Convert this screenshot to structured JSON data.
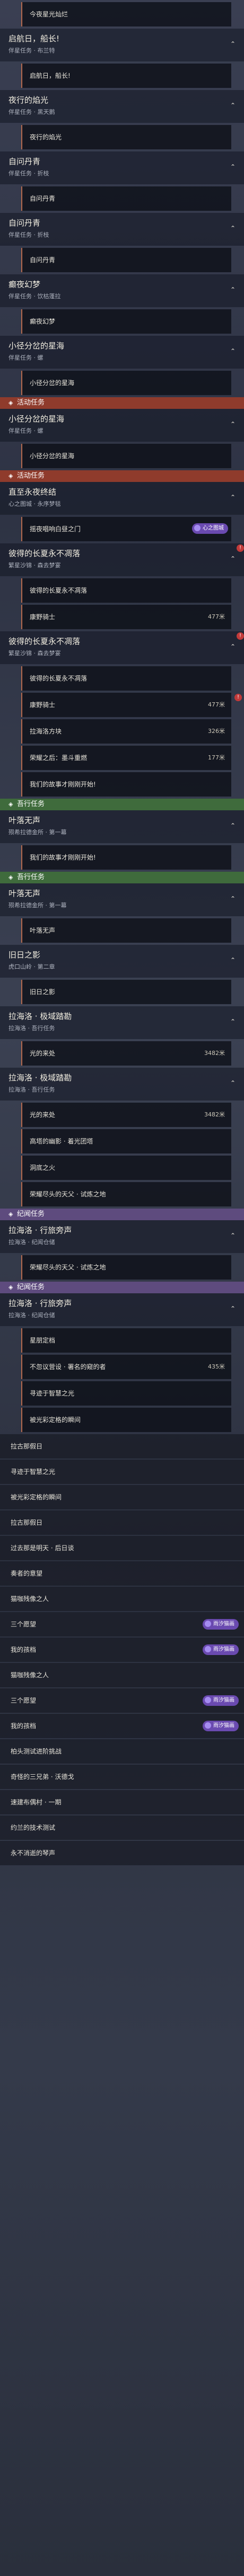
{
  "panel": [
    {
      "kind": "sub",
      "text": "今夜星光灿烂"
    },
    {
      "kind": "head",
      "title": "启航日，船长!",
      "sub": "伴星任务 · 布兰特",
      "chev": "⌃"
    },
    {
      "kind": "sub",
      "text": "启航日，船长!"
    },
    {
      "kind": "head",
      "title": "夜行的焰光",
      "sub": "伴星任务 · 黑天鹅",
      "chev": "⌃"
    },
    {
      "kind": "sub",
      "text": "夜行的焰光"
    },
    {
      "kind": "head",
      "title": "自问丹青",
      "sub": "伴星任务 · 折枝",
      "chev": "⌃"
    },
    {
      "kind": "sub",
      "text": "自问丹青"
    },
    {
      "kind": "head",
      "title": "自问丹青",
      "sub": "伴星任务 · 折枝",
      "chev": "⌃"
    },
    {
      "kind": "sub",
      "text": "自问丹青"
    },
    {
      "kind": "head",
      "title": "癫夜幻梦",
      "sub": "伴星任务 · 饮枯蓬拉",
      "chev": "⌃"
    },
    {
      "kind": "sub",
      "text": "癫夜幻梦"
    },
    {
      "kind": "head",
      "title": "小径分岔的星海",
      "sub": "伴星任务 · 螺",
      "chev": "⌃"
    },
    {
      "kind": "sub",
      "text": "小径分岔的星海"
    },
    {
      "kind": "sec",
      "color": "red",
      "label": "活动任务"
    },
    {
      "kind": "head",
      "title": "小径分岔的星海",
      "sub": "伴星任务 · 螺",
      "chev": "⌃"
    },
    {
      "kind": "sub",
      "text": "小径分岔的星海"
    },
    {
      "kind": "sec",
      "color": "red",
      "label": "活动任务"
    },
    {
      "kind": "head",
      "title": "直至永夜终结",
      "sub": "心之图城 · 永序梦毯",
      "chev": "⌃"
    },
    {
      "kind": "sub",
      "text": "摇夜唱响白昼之门",
      "tag": "心之图城"
    },
    {
      "kind": "head",
      "title": "彼得的长夏永不凋落",
      "sub": "繁星沙锦 · 森去梦宴",
      "chev": "⌃",
      "mark": "!"
    },
    {
      "kind": "sub",
      "text": "彼得的长夏永不凋落"
    },
    {
      "kind": "sub",
      "text": "康野骑士",
      "reward": "477米"
    },
    {
      "kind": "head",
      "title": "彼得的长夏永不凋落",
      "sub": "繁星沙锦 · 森去梦宴",
      "chev": "⌃",
      "mark": "!"
    },
    {
      "kind": "sub",
      "text": "彼得的长夏永不凋落"
    },
    {
      "kind": "sub",
      "text": "康野骑士",
      "reward": "477米",
      "mark": "!"
    },
    {
      "kind": "sub",
      "text": "拉海洛方块",
      "reward": "326米"
    },
    {
      "kind": "sub",
      "text": "荣耀之后：墨斗重燃",
      "reward": "177米"
    },
    {
      "kind": "sub",
      "text": "我们的故事才刚刚开始!"
    },
    {
      "kind": "sec",
      "color": "green",
      "label": "吾行任务"
    },
    {
      "kind": "head",
      "title": "叶落无声",
      "sub": "殒希拉德金所 · 第一幕",
      "chev": "⌃"
    },
    {
      "kind": "sub",
      "text": "我们的故事才刚刚开始!"
    },
    {
      "kind": "sec",
      "color": "green",
      "label": "吾行任务"
    },
    {
      "kind": "head",
      "title": "叶落无声",
      "sub": "殒希拉德金所 · 第一幕",
      "chev": "⌃"
    },
    {
      "kind": "sub",
      "text": "叶落无声"
    },
    {
      "kind": "head",
      "title": "旧日之影",
      "sub": "虎口山岭 · 第二章",
      "chev": "⌃"
    },
    {
      "kind": "sub",
      "text": "旧日之影"
    },
    {
      "kind": "head",
      "title": "拉海洛 · 极域踏勘",
      "sub": "拉海洛 · 吾行任务",
      "chev": "⌃"
    },
    {
      "kind": "sub",
      "text": "光的来处",
      "reward": "3482米"
    },
    {
      "kind": "head",
      "title": "拉海洛 · 极域踏勘",
      "sub": "拉海洛 · 吾行任务",
      "chev": "⌃"
    },
    {
      "kind": "sub",
      "text": "光的来处",
      "reward": "3482米"
    },
    {
      "kind": "sub",
      "text": "高塔的幽影 · 着光团塔"
    },
    {
      "kind": "sub",
      "text": "洞底之火"
    },
    {
      "kind": "sub",
      "text": "荣耀尽头的天父 · 试炼之地"
    },
    {
      "kind": "sec",
      "color": "purple",
      "label": "纪闻任务"
    },
    {
      "kind": "head",
      "title": "拉海洛 · 行旅旁声",
      "sub": "拉海洛 · 纪闻仓储",
      "chev": "⌃"
    },
    {
      "kind": "sub",
      "text": "荣耀尽头的天父 · 试炼之地"
    },
    {
      "kind": "sec",
      "color": "purple",
      "label": "纪闻任务"
    },
    {
      "kind": "head",
      "title": "拉海洛 · 行旅旁声",
      "sub": "拉海洛 · 纪闻仓储",
      "chev": "⌃"
    },
    {
      "kind": "sub",
      "text": "星朋定档"
    },
    {
      "kind": "sub",
      "text": "不忽议营设 · 署名的窥的者",
      "reward": "435米"
    },
    {
      "kind": "sub",
      "text": "寻迹于智慧之光"
    },
    {
      "kind": "sub",
      "text": "被光彩定格的瞬间"
    },
    {
      "kind": "row",
      "text": "拉古那假日"
    },
    {
      "kind": "row",
      "text": "寻迹于智慧之光"
    },
    {
      "kind": "row",
      "text": "被光彩定格的瞬间"
    },
    {
      "kind": "row",
      "text": "拉古那假日"
    },
    {
      "kind": "row",
      "text": "过去那是明天 · 后日谈"
    },
    {
      "kind": "row",
      "text": "奏者的意望"
    },
    {
      "kind": "row",
      "text": "猫咖残像之人"
    },
    {
      "kind": "row",
      "text": "三个愿望",
      "tag": "雨汐猫画"
    },
    {
      "kind": "row",
      "text": "我的孩档",
      "tag": "雨汐猫画"
    },
    {
      "kind": "row",
      "text": "猫咖残像之人"
    },
    {
      "kind": "row",
      "text": "三个愿望",
      "tag": "雨汐猫画"
    },
    {
      "kind": "row",
      "text": "我的孩档",
      "tag": "雨汐猫画"
    },
    {
      "kind": "row",
      "text": "柏头测试进阶挑战"
    },
    {
      "kind": "row",
      "text": "奇怪的三兄弟 · 沃德戈"
    },
    {
      "kind": "row",
      "text": "速建布偶村 · 一期"
    },
    {
      "kind": "row",
      "text": "约兰的技术测试"
    },
    {
      "kind": "row",
      "text": "永不消逝的琴声"
    }
  ]
}
